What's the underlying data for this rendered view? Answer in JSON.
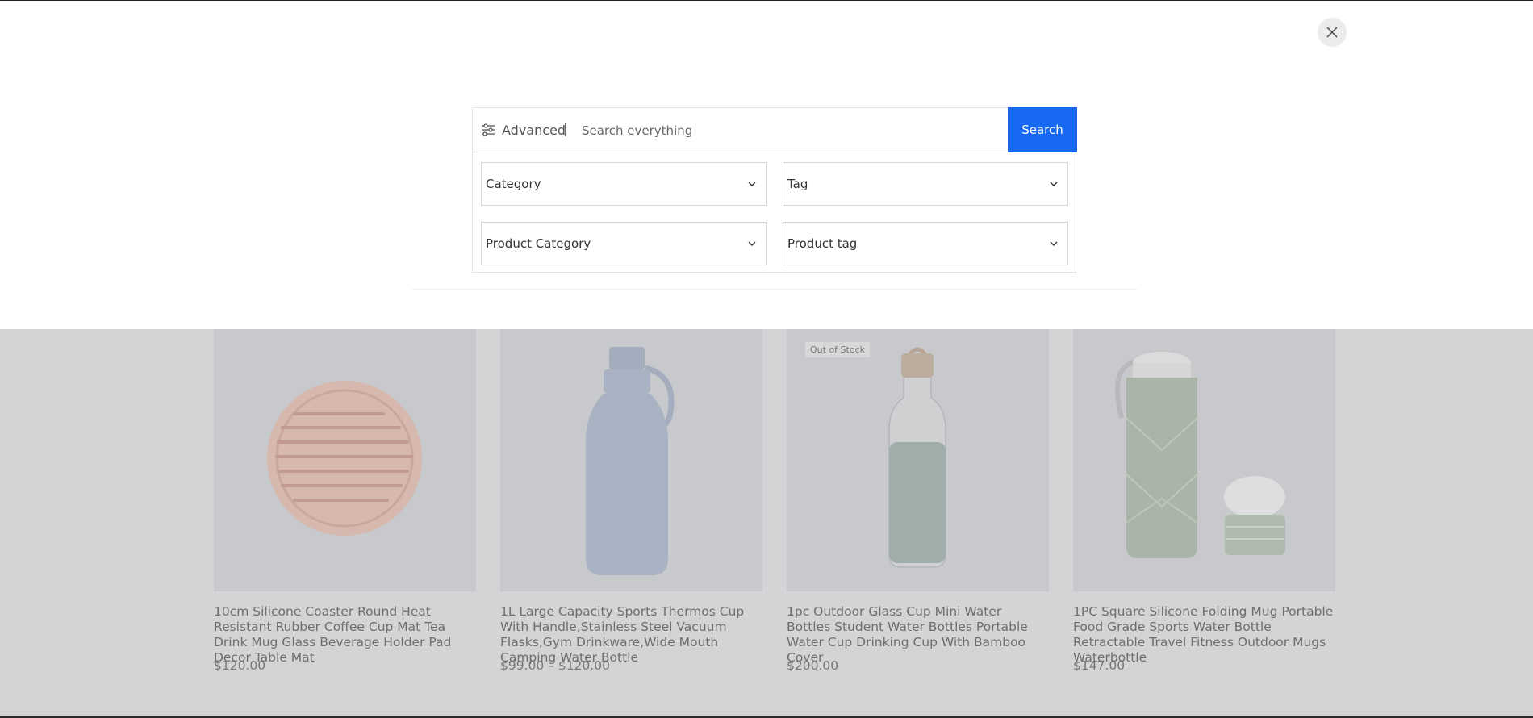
{
  "search": {
    "advanced_label": "Advanced",
    "separator": "|",
    "placeholder": "Search everything",
    "button_label": "Search",
    "filters": {
      "category": "Category",
      "tag": "Tag",
      "product_category": "Product Category",
      "product_tag": "Product tag"
    }
  },
  "products": [
    {
      "title": "10cm Silicone Coaster Round Heat Resistant Rubber Coffee Cup Mat Tea Drink Mug Glass Beverage Holder Pad Decor Table Mat",
      "price": "$120.00",
      "badge": ""
    },
    {
      "title": "1L Large Capacity Sports Thermos Cup With Handle,Stainless Steel Vacuum Flasks,Gym Drinkware,Wide Mouth Camping Water Bottle",
      "price": "$99.00 – $120.00",
      "badge": ""
    },
    {
      "title": "1pc Outdoor Glass Cup Mini Water Bottles Student Water Bottles Portable Water Cup Drinking Cup With Bamboo Cover",
      "price": "$200.00",
      "badge": "Out of Stock"
    },
    {
      "title": "1PC Square Silicone Folding Mug Portable Food Grade Sports Water Bottle Retractable Travel Fitness Outdoor Mugs Waterbottle",
      "price": "$147.00",
      "badge": ""
    }
  ],
  "icons": {
    "close": "close-icon",
    "advanced": "sliders-icon",
    "dropdown": "chevron-down-icon"
  },
  "colors": {
    "accent": "#1669f0"
  }
}
